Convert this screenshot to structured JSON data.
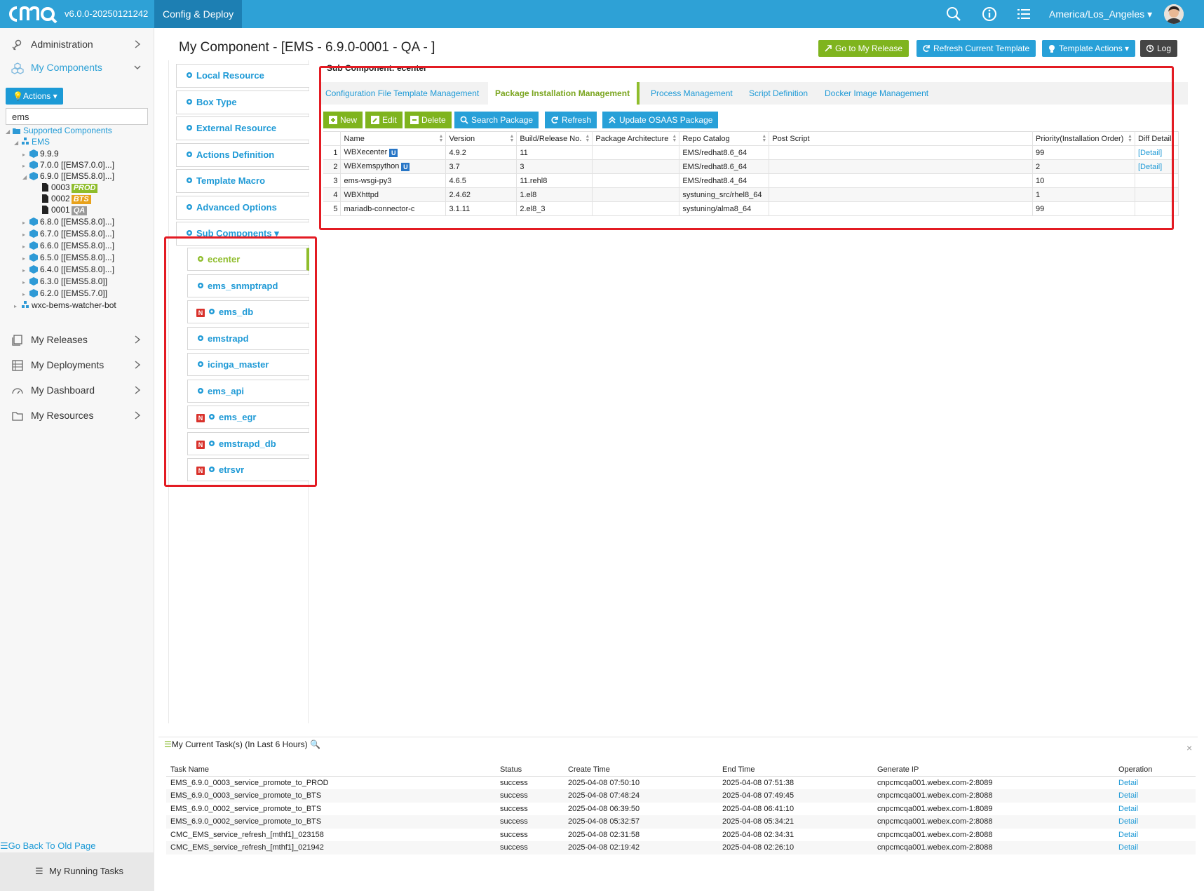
{
  "topbar": {
    "version": "v6.0.0-20250121242",
    "tab": "Config & Deploy",
    "timezone": "America/Los_Angeles",
    "accent_color": "#2ea1d6"
  },
  "sidebar": {
    "nav_top": [
      {
        "label": "Administration",
        "icon": "admin-icon"
      },
      {
        "label": "My Components",
        "icon": "components-icon"
      }
    ],
    "actions_label": "Actions",
    "search_value": "ems",
    "tree": {
      "root": "Supported Components",
      "group": "EMS",
      "items": [
        {
          "label": "9.9.9"
        },
        {
          "label": "7.0.0 [[EMS7.0.0]...]"
        },
        {
          "label": "6.9.0 [[EMS5.8.0]...]"
        },
        {
          "label": "0003",
          "badge": "PROD",
          "badge_color": "#8fbd2c"
        },
        {
          "label": "0002",
          "badge": "BTS",
          "badge_color": "#e8a21c"
        },
        {
          "label": "0001",
          "badge": "QA",
          "badge_color": "#9a9a9a"
        },
        {
          "label": "6.8.0 [[EMS5.8.0]...]"
        },
        {
          "label": "6.7.0 [[EMS5.8.0]...]"
        },
        {
          "label": "6.6.0 [[EMS5.8.0]...]"
        },
        {
          "label": "6.5.0 [[EMS5.8.0]...]"
        },
        {
          "label": "6.4.0 [[EMS5.8.0]...]"
        },
        {
          "label": "6.3.0 [[EMS5.8.0]]"
        },
        {
          "label": "6.2.0 [[EMS5.7.0]]"
        }
      ],
      "other_group": "wxc-bems-watcher-bot"
    },
    "nav_bottom": [
      {
        "label": "My Releases"
      },
      {
        "label": "My Deployments"
      },
      {
        "label": "My Dashboard"
      },
      {
        "label": "My Resources"
      }
    ],
    "go_back": "Go Back To Old Page",
    "running_tasks": "My Running Tasks"
  },
  "main": {
    "title": "My Component - [EMS - 6.9.0-0001 - QA - ]",
    "header_buttons": [
      {
        "label": "Go to My Release",
        "color": "#7fb41e"
      },
      {
        "label": "Refresh Current Template",
        "color": "#27a0d8"
      },
      {
        "label": "Template Actions",
        "color": "#27a0d8"
      },
      {
        "label": "Log",
        "color": "#444444"
      }
    ],
    "menu": [
      "Local Resource",
      "Box Type",
      "External Resource",
      "Actions Definition",
      "Template Macro",
      "Advanced Options",
      "Sub Components"
    ],
    "sub_components": [
      {
        "label": "ecenter",
        "active": true,
        "new": false
      },
      {
        "label": "ems_snmptrapd",
        "new": false
      },
      {
        "label": "ems_db",
        "new": true
      },
      {
        "label": "emstrapd",
        "new": false
      },
      {
        "label": "icinga_master",
        "new": false
      },
      {
        "label": "ems_api",
        "new": false
      },
      {
        "label": "ems_egr",
        "new": true
      },
      {
        "label": "emstrapd_db",
        "new": true
      },
      {
        "label": "etrsvr",
        "new": true
      }
    ],
    "new_badge": "N",
    "subtitle": "Sub Component: ecenter",
    "tabs": [
      "Configuration File Template Management",
      "Package Installation Management",
      "Process Management",
      "Script Definition",
      "Docker Image Management"
    ],
    "toolbar": [
      "New",
      "Edit",
      "Delete",
      "Search Package",
      "Refresh",
      "Update OSAAS Package"
    ],
    "packages": {
      "columns": [
        "",
        "Name",
        "Version",
        "Build/Release No.",
        "Package Architecture",
        "Repo Catalog",
        "Post Script",
        "Priority(Installation Order)",
        "Diff Detail"
      ],
      "rows": [
        {
          "n": "1",
          "name": "WBXecenter",
          "u": "U",
          "version": "4.9.2",
          "build": "11",
          "arch": "",
          "repo": "EMS/redhat8.6_64",
          "post": "",
          "priority": "99",
          "diff": "[Detail]"
        },
        {
          "n": "2",
          "name": "WBXemspython",
          "u": "U",
          "version": "3.7",
          "build": "3",
          "arch": "",
          "repo": "EMS/redhat8.6_64",
          "post": "",
          "priority": "2",
          "diff": "[Detail]"
        },
        {
          "n": "3",
          "name": "ems-wsgi-py3",
          "u": "",
          "version": "4.6.5",
          "build": "11.rehl8",
          "arch": "",
          "repo": "EMS/redhat8.4_64",
          "post": "",
          "priority": "10",
          "diff": ""
        },
        {
          "n": "4",
          "name": "WBXhttpd",
          "u": "",
          "version": "2.4.62",
          "build": "1.el8",
          "arch": "",
          "repo": "systuning_src/rhel8_64",
          "post": "",
          "priority": "1",
          "diff": ""
        },
        {
          "n": "5",
          "name": "mariadb-connector-c",
          "u": "",
          "version": "3.1.11",
          "build": "2.el8_3",
          "arch": "",
          "repo": "systuning/alma8_64",
          "post": "",
          "priority": "99",
          "diff": ""
        }
      ]
    }
  },
  "tasks": {
    "title": "My Current Task(s) (In Last 6 Hours)",
    "columns": [
      "Task Name",
      "Status",
      "Create Time",
      "End Time",
      "Generate IP",
      "Operation"
    ],
    "rows": [
      [
        "EMS_6.9.0_0003_service_promote_to_PROD",
        "success",
        "2025-04-08 07:50:10",
        "2025-04-08 07:51:38",
        "cnpcmcqa001.webex.com-2:8089",
        "Detail"
      ],
      [
        "EMS_6.9.0_0003_service_promote_to_BTS",
        "success",
        "2025-04-08 07:48:24",
        "2025-04-08 07:49:45",
        "cnpcmcqa001.webex.com-2:8088",
        "Detail"
      ],
      [
        "EMS_6.9.0_0002_service_promote_to_BTS",
        "success",
        "2025-04-08 06:39:50",
        "2025-04-08 06:41:10",
        "cnpcmcqa001.webex.com-1:8089",
        "Detail"
      ],
      [
        "EMS_6.9.0_0002_service_promote_to_BTS",
        "success",
        "2025-04-08 05:32:57",
        "2025-04-08 05:34:21",
        "cnpcmcqa001.webex.com-2:8088",
        "Detail"
      ],
      [
        "CMC_EMS_service_refresh_[mthf1]_023158",
        "success",
        "2025-04-08 02:31:58",
        "2025-04-08 02:34:31",
        "cnpcmcqa001.webex.com-2:8088",
        "Detail"
      ],
      [
        "CMC_EMS_service_refresh_[mthf1]_021942",
        "success",
        "2025-04-08 02:19:42",
        "2025-04-08 02:26:10",
        "cnpcmcqa001.webex.com-2:8088",
        "Detail"
      ]
    ]
  },
  "highlight_color": "#e31b23"
}
